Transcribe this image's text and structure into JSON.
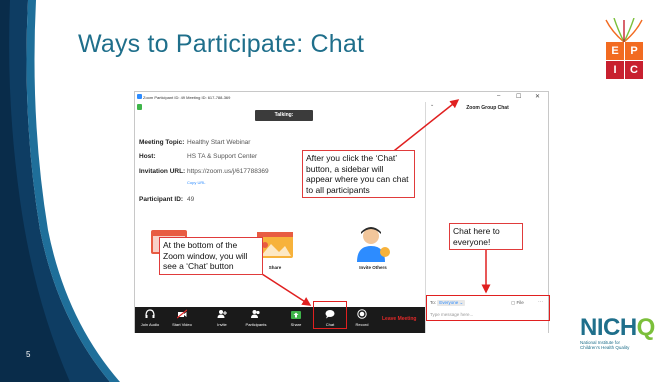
{
  "slide": {
    "title": "Ways to Participate: Chat",
    "number": "5"
  },
  "logos": {
    "epic_letters": [
      "E",
      "P",
      "I",
      "C"
    ],
    "epic_colors": [
      "#f26b21",
      "#f26b21",
      "#c8202f",
      "#c8202f"
    ],
    "nichq_word_a": "NICH",
    "nichq_word_b": "Q",
    "nichq_line1": "National Institute for",
    "nichq_line2": "Children's Health Quality"
  },
  "zoom": {
    "window_title": "Zoom Participant ID: 49   Meeting ID: 617-788-369",
    "win_min": "–",
    "win_max": "☐",
    "win_close": "✕",
    "talking": "Talking:",
    "meeting_topic_label": "Meeting Topic:",
    "meeting_topic_value": "Healthy Start Webinar",
    "host_label": "Host:",
    "host_value": "HS TA & Support Center",
    "invite_label": "Invitation URL:",
    "invite_value": "https://zoom.us/j/617788369",
    "copy_url": "Copy URL",
    "participant_label": "Participant ID:",
    "participant_value": "49",
    "share_label": "Share",
    "invite_others_label": "Invite Others",
    "toolbar": {
      "join_audio": "Join Audio",
      "start_video": "Start Video",
      "invite": "Invite",
      "participants": "Participants",
      "participants_count": "1",
      "share": "Share",
      "chat": "Chat",
      "record": "Record",
      "leave": "Leave Meeting"
    },
    "chat_panel": {
      "header": "Zoom Group Chat",
      "chevron": "⌄",
      "to_label": "To:",
      "to_value": "Everyone ⌄",
      "file": "File",
      "more": "···",
      "placeholder": "Type message here..."
    }
  },
  "callouts": {
    "sidebar": "After you click the ‘Chat’ button, a sidebar will appear where you can chat to all participants",
    "bottom": "At the bottom of the Zoom window, you will see a ‘Chat’ button",
    "chat_here": "Chat here to everyone!"
  },
  "colors": {
    "title": "#1f6f8b",
    "band_dark": "#0e3d63",
    "band_light": "#1f6f9a",
    "annotation_red": "#e02020"
  }
}
